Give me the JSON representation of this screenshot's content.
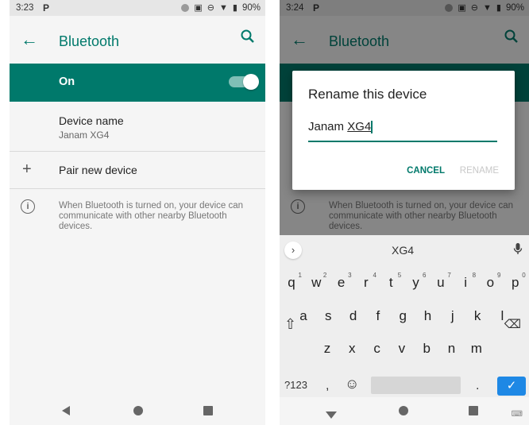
{
  "left": {
    "status": {
      "time": "3:23",
      "p": "P",
      "battery": "90%"
    },
    "appbar": {
      "title": "Bluetooth"
    },
    "on_row": {
      "label": "On"
    },
    "device": {
      "label": "Device name",
      "value": "Janam XG4"
    },
    "pair": {
      "label": "Pair new device"
    },
    "info": {
      "text": "When Bluetooth is turned on, your device can communicate with other nearby Bluetooth devices."
    }
  },
  "right": {
    "status": {
      "time": "3:24",
      "p": "P",
      "battery": "90%"
    },
    "appbar": {
      "title": "Bluetooth"
    },
    "info": {
      "text": "When Bluetooth is turned on, your device can communicate with other nearby Bluetooth devices."
    },
    "dialog": {
      "title": "Rename this device",
      "value_prefix": "Janam ",
      "value_underlined": "XG4",
      "cancel": "CANCEL",
      "rename": "RENAME"
    },
    "keyboard": {
      "suggestion": "XG4",
      "row1": [
        "q",
        "w",
        "e",
        "r",
        "t",
        "y",
        "u",
        "i",
        "o",
        "p"
      ],
      "row1_hints": [
        "1",
        "2",
        "3",
        "4",
        "5",
        "6",
        "7",
        "8",
        "9",
        "0"
      ],
      "row2": [
        "a",
        "s",
        "d",
        "f",
        "g",
        "h",
        "j",
        "k",
        "l"
      ],
      "row3": [
        "z",
        "x",
        "c",
        "v",
        "b",
        "n",
        "m"
      ],
      "symbols": "?123",
      "comma": ",",
      "period": "."
    }
  },
  "colors": {
    "accent": "#00796b",
    "enter": "#1e88e5"
  }
}
